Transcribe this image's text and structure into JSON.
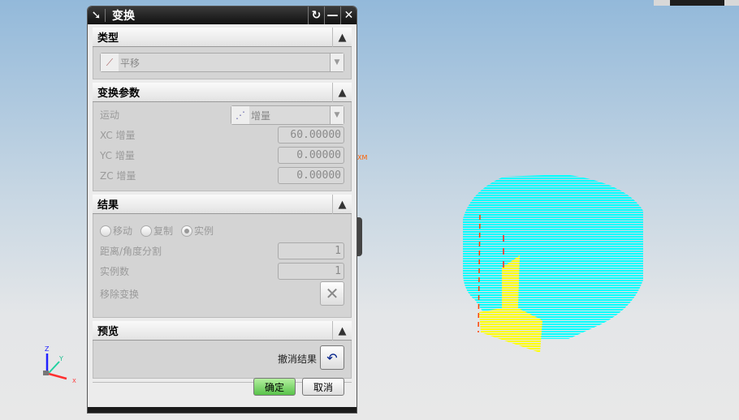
{
  "dialog": {
    "title": "变换",
    "sections": {
      "type": {
        "header": "类型",
        "value": "平移"
      },
      "params": {
        "header": "变换参数",
        "motion_label": "运动",
        "motion_value": "增量",
        "xc_label": "XC 增量",
        "xc_value": "60.00000",
        "yc_label": "YC 增量",
        "yc_value": "0.00000",
        "zc_label": "ZC 增量",
        "zc_value": "0.00000"
      },
      "result": {
        "header": "结果",
        "options": [
          "移动",
          "复制",
          "实例"
        ],
        "selected": "实例",
        "split_label": "距离/角度分割",
        "split_value": "1",
        "count_label": "实例数",
        "count_value": "1",
        "remove_label": "移除变换"
      },
      "preview": {
        "header": "预览",
        "undo_label": "撤消结果"
      }
    },
    "ok": "确定",
    "cancel": "取消"
  },
  "viewport": {
    "wcs_label": "XM",
    "axes": {
      "x": "X",
      "y": "Y",
      "z": "Z"
    }
  },
  "colors": {
    "model": "#00ffff",
    "selection": "#ffff00",
    "axis_x": "#ff3030",
    "axis_y": "#20d0a0",
    "axis_z": "#2020ff"
  }
}
